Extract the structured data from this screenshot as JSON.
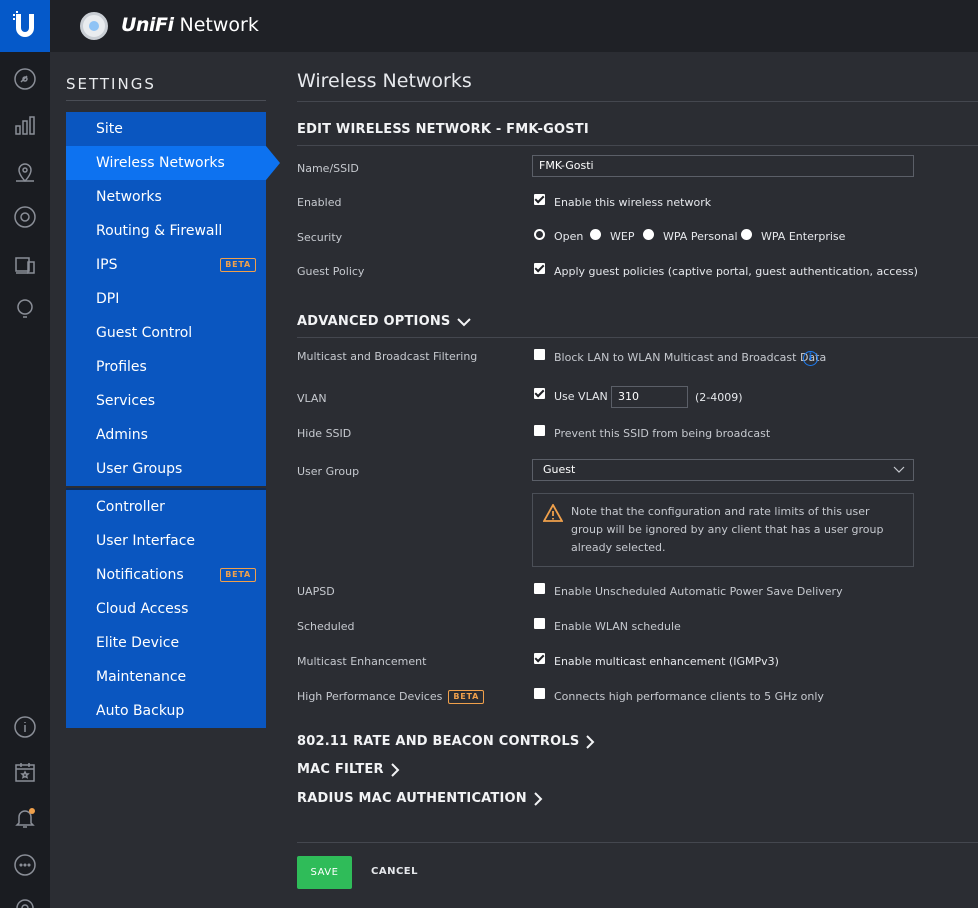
{
  "app": {
    "brand_prefix": "UniFi",
    "brand_suffix": " Network"
  },
  "settings_nav": {
    "title": "SETTINGS",
    "group1": [
      {
        "label": "Site"
      },
      {
        "label": "Wireless Networks"
      },
      {
        "label": "Networks"
      },
      {
        "label": "Routing & Firewall"
      },
      {
        "label": "IPS",
        "badge": "BETA"
      },
      {
        "label": "DPI"
      },
      {
        "label": "Guest Control"
      },
      {
        "label": "Profiles"
      },
      {
        "label": "Services"
      },
      {
        "label": "Admins"
      },
      {
        "label": "User Groups"
      }
    ],
    "group2": [
      {
        "label": "Controller"
      },
      {
        "label": "User Interface"
      },
      {
        "label": "Notifications",
        "badge": "BETA"
      },
      {
        "label": "Cloud Access"
      },
      {
        "label": "Elite Device"
      },
      {
        "label": "Maintenance"
      },
      {
        "label": "Auto Backup"
      }
    ],
    "active": "Wireless Networks"
  },
  "main": {
    "page_title": "Wireless Networks",
    "edit_heading": "EDIT WIRELESS NETWORK - FMK-GOSTI",
    "name_label": "Name/SSID",
    "name_value": "FMK-Gosti",
    "enabled_label": "Enabled",
    "enabled_text": "Enable this wireless network",
    "enabled_checked": true,
    "security_label": "Security",
    "security_options": [
      "Open",
      "WEP",
      "WPA Personal",
      "WPA Enterprise"
    ],
    "security_selected": "Open",
    "guest_label": "Guest Policy",
    "guest_text": "Apply guest policies (captive portal, guest authentication, access)",
    "guest_checked": true,
    "advanced_heading": "ADVANCED OPTIONS",
    "multicast_label": "Multicast and Broadcast Filtering",
    "multicast_text": "Block LAN to WLAN Multicast and Broadcast Data",
    "multicast_checked": false,
    "vlan_label": "VLAN",
    "vlan_text": "Use VLAN",
    "vlan_checked": true,
    "vlan_value": "310",
    "vlan_range": "(2-4009)",
    "hide_label": "Hide SSID",
    "hide_text": "Prevent this SSID from being broadcast",
    "hide_checked": false,
    "usergroup_label": "User Group",
    "usergroup_value": "Guest",
    "usergroup_note": "Note that the configuration and rate limits of this user group will be ignored by any client that has a user group already selected.",
    "uapsd_label": "UAPSD",
    "uapsd_text": "Enable Unscheduled Automatic Power Save Delivery",
    "uapsd_checked": false,
    "scheduled_label": "Scheduled",
    "scheduled_text": "Enable WLAN schedule",
    "scheduled_checked": false,
    "mcast_enh_label": "Multicast Enhancement",
    "mcast_enh_text": "Enable multicast enhancement (IGMPv3)",
    "mcast_enh_checked": true,
    "hpd_label": "High Performance Devices",
    "hpd_badge": "BETA",
    "hpd_text": "Connects high performance clients to 5 GHz only",
    "hpd_checked": false,
    "rate_heading": "802.11 RATE AND BEACON CONTROLS",
    "mac_heading": "MAC FILTER",
    "radius_heading": "RADIUS MAC AUTHENTICATION",
    "save_label": "SAVE",
    "cancel_label": "CANCEL"
  },
  "colors": {
    "accent": "#0a56c0",
    "active": "#0d72f0",
    "save": "#2fbc59",
    "beta": "#f0a04b"
  }
}
